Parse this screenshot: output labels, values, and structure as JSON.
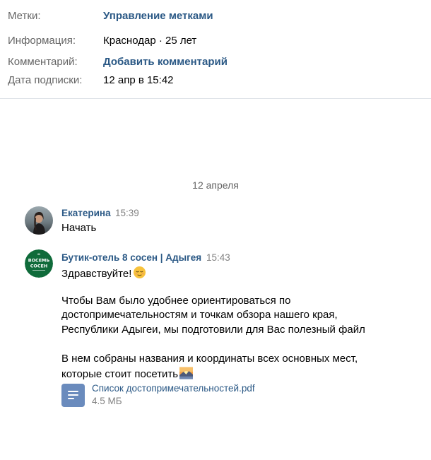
{
  "profile_info": {
    "rows": [
      {
        "label": "Метки:",
        "value": "Управление метками"
      },
      {
        "label": "Информация:",
        "value": "Краснодар · 25 лет"
      },
      {
        "label": "Комментарий:",
        "value": "Добавить комментарий"
      },
      {
        "label": "Дата подписки:",
        "value": "12 апр в 15:42"
      }
    ]
  },
  "history": {
    "date_separator": "12 апреля",
    "messages": [
      {
        "author": "Екатерина",
        "time": "15:39",
        "avatar_icon": "user-photo-icon",
        "lines": [
          "Начать"
        ]
      },
      {
        "author": "Бутик-отель 8 сосен | Адыгея",
        "time": "15:43",
        "avatar_icon": "hotel-logo-icon",
        "avatar_logo_text": [
          "ВОСЕМЬ",
          "СОСЕН"
        ],
        "lines": [
          "Здравствуйте!",
          "Чтобы Вам было удобнее ориентироваться по",
          "достопримечательностям и точкам обзора нашего края,",
          "Республики Адыгеи, мы подготовили для Вас полезный файл",
          "В нем собраны названия и координаты всех основных мест,",
          "которые стоит посетить"
        ],
        "emojis": [
          "relieved-face-emoji",
          "sunrise-emoji"
        ],
        "attachment": {
          "icon": "document-icon",
          "title": "Список достопримечательностей.pdf",
          "size": "4.5 МБ"
        }
      }
    ]
  },
  "colors": {
    "link": "#2a5885",
    "label": "#656565",
    "muted": "#828282",
    "divider": "#dce1e6",
    "doc_icon": "#6a8bbd",
    "hotel_logo_bg": "#0f6b3a"
  }
}
